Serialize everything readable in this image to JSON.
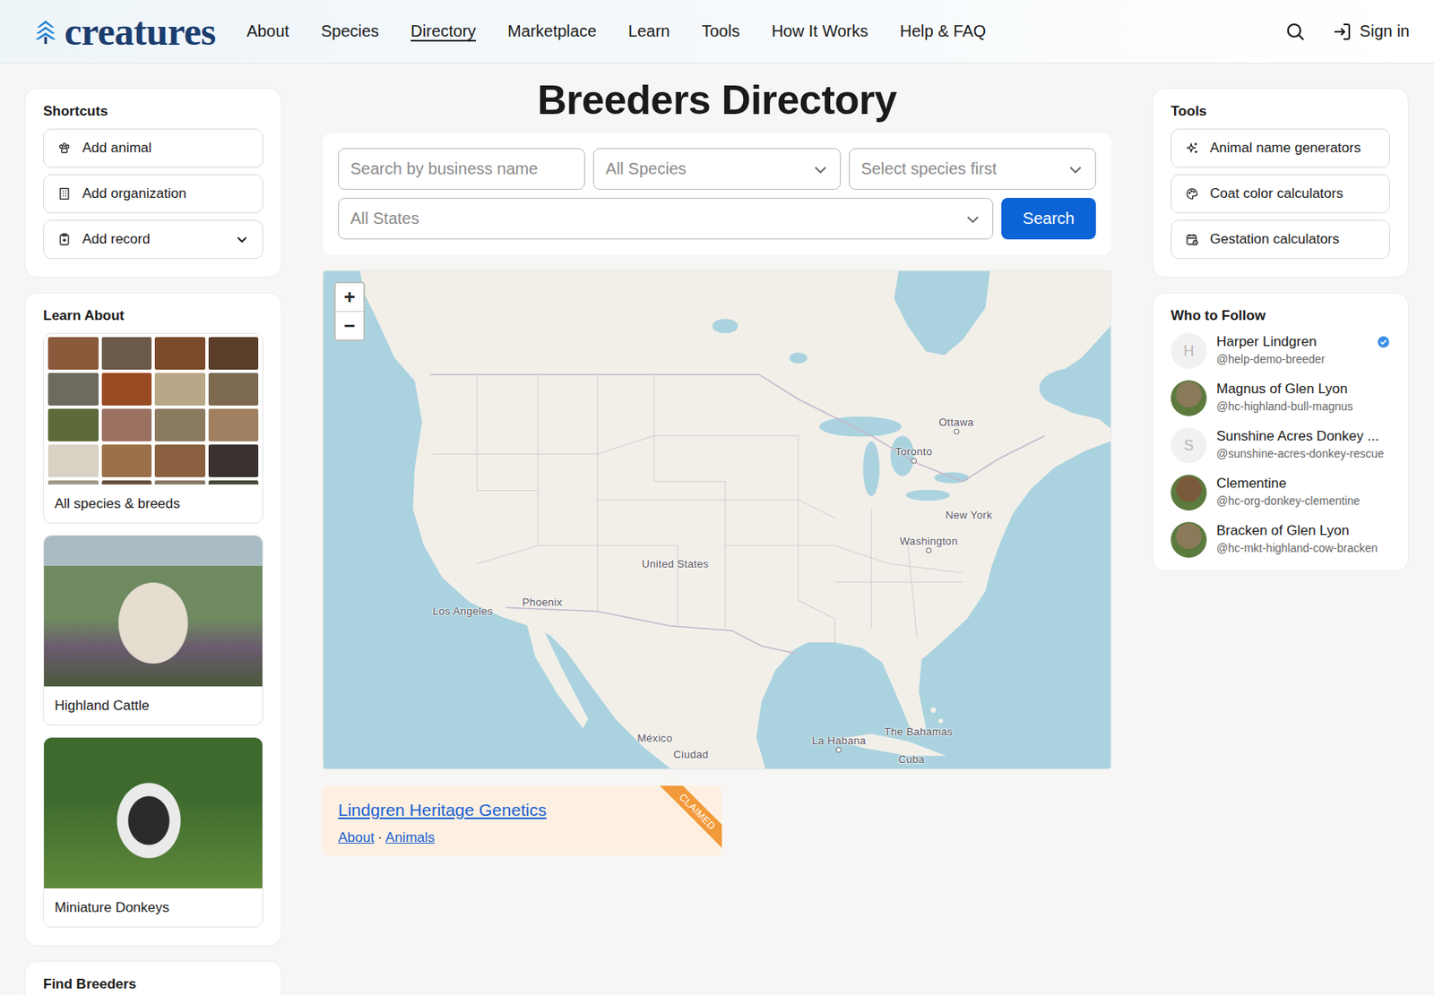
{
  "logo": {
    "text": "creatures"
  },
  "nav": [
    {
      "label": "About",
      "selected": false
    },
    {
      "label": "Species",
      "selected": false
    },
    {
      "label": "Directory",
      "selected": true
    },
    {
      "label": "Marketplace",
      "selected": false
    },
    {
      "label": "Learn",
      "selected": false
    },
    {
      "label": "Tools",
      "selected": false
    },
    {
      "label": "How It Works",
      "selected": false
    },
    {
      "label": "Help & FAQ",
      "selected": false
    }
  ],
  "header_actions": {
    "sign_in": "Sign in"
  },
  "shortcuts": {
    "title": "Shortcuts",
    "items": [
      {
        "label": "Add animal",
        "expandable": false
      },
      {
        "label": "Add organization",
        "expandable": false
      },
      {
        "label": "Add record",
        "expandable": true
      }
    ]
  },
  "learn": {
    "title": "Learn About",
    "cards": [
      {
        "label": "All species & breeds",
        "kind": "collage"
      },
      {
        "label": "Highland Cattle",
        "kind": "cattle"
      },
      {
        "label": "Miniature Donkeys",
        "kind": "donkey"
      }
    ]
  },
  "find_breeders": {
    "title": "Find Breeders"
  },
  "page_title": "Breeders Directory",
  "filters": {
    "search_placeholder": "Search by business name",
    "species": "All Species",
    "breed": "Select species first",
    "state": "All States",
    "button": "Search"
  },
  "map": {
    "zoom_in": "+",
    "zoom_out": "−",
    "labels": [
      {
        "text": "Ottawa",
        "marker": true
      },
      {
        "text": "Toronto",
        "marker": true
      },
      {
        "text": "New York",
        "marker": false
      },
      {
        "text": "Washington",
        "marker": true
      },
      {
        "text": "United States",
        "marker": false
      },
      {
        "text": "Phoenix",
        "marker": false
      },
      {
        "text": "Los Angeles",
        "marker": false
      },
      {
        "text": "México",
        "marker": false
      },
      {
        "text": "La Habana",
        "marker": true
      },
      {
        "text": "The Bahamas",
        "marker": false
      },
      {
        "text": "Cuba",
        "marker": false
      },
      {
        "text": "Ciudad",
        "marker": false
      }
    ]
  },
  "results": [
    {
      "name": "Lindgren Heritage Genetics",
      "links": [
        "About",
        "Animals"
      ],
      "separator": "·",
      "badge": "CLAIMED",
      "claimed": true
    }
  ],
  "tools": {
    "title": "Tools",
    "items": [
      "Animal name generators",
      "Coat color calculators",
      "Gestation calculators"
    ]
  },
  "follow": {
    "title": "Who to Follow",
    "people": [
      {
        "name": "Harper Lindgren",
        "handle": "@help-demo-breeder",
        "verified": true,
        "kind": "letter",
        "initial": "H"
      },
      {
        "name": "Magnus of Glen Lyon",
        "handle": "@hc-highland-bull-magnus",
        "verified": false,
        "kind": "photo",
        "initial": ""
      },
      {
        "name": "Sunshine Acres Donkey ...",
        "handle": "@sunshine-acres-donkey-rescue",
        "verified": false,
        "kind": "letter",
        "initial": "S"
      },
      {
        "name": "Clementine",
        "handle": "@hc-org-donkey-clementine",
        "verified": false,
        "kind": "photo",
        "initial": ""
      },
      {
        "name": "Bracken of Glen Lyon",
        "handle": "@hc-mkt-highland-cow-bracken",
        "verified": false,
        "kind": "photo",
        "initial": ""
      }
    ]
  }
}
